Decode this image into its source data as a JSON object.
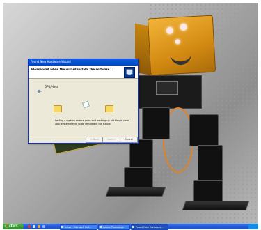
{
  "wizard": {
    "title": "Found New Hardware Wizard",
    "heading": "Please wait while the wizard installs the software...",
    "device_name": "GPU/Hess",
    "message": "Setting a system restore point and backing up old files in case your system needs to be restored in the future.",
    "buttons": {
      "back": "< Back",
      "next": "Next >",
      "cancel": "Cancel"
    }
  },
  "taskbar": {
    "start_label": "start",
    "tasks": [
      {
        "label": "Inbox - Microsoft Out..."
      },
      {
        "label": "Adobe Photoshop"
      },
      {
        "label": "Found New Hardware..."
      }
    ]
  },
  "colors": {
    "xp_blue": "#0a5fd8",
    "start_green": "#3a9b34",
    "robot_orange": "#e09a1f"
  }
}
